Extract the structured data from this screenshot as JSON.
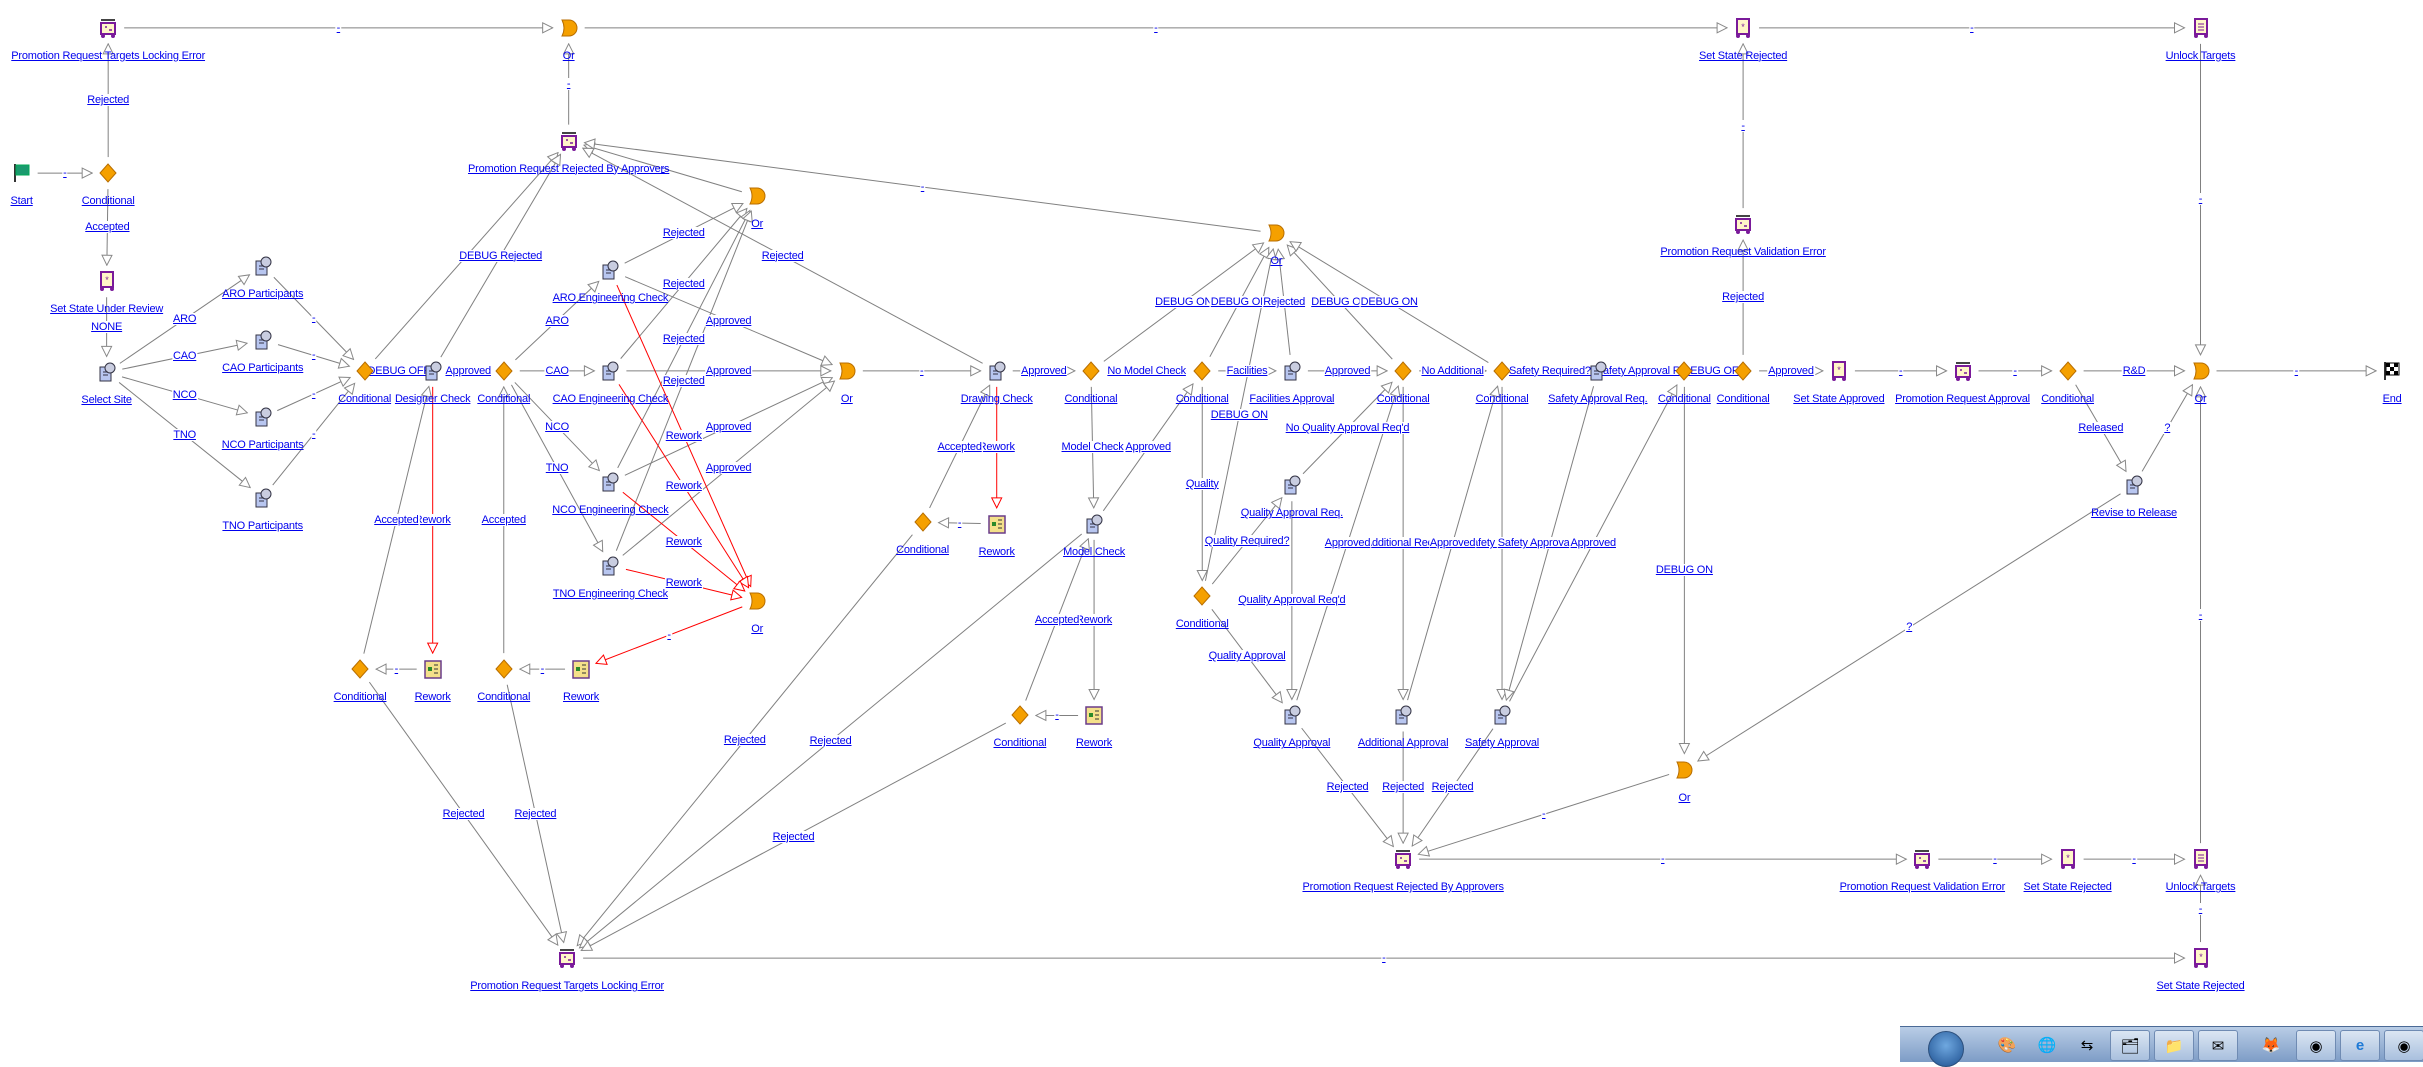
{
  "colors": {
    "link": "#0000ee",
    "edge": "#808080",
    "rework_edge": "#ff0000",
    "conditional": "#f5a000",
    "or_gate": "#f5a000",
    "task": "#a9b8e8",
    "state": "#7a1a9a"
  },
  "nodes": [
    {
      "label": "Promotion Request Targets Locking Error",
      "type": "error"
    },
    {
      "label": "Or",
      "type": "or"
    },
    {
      "label": "Set State Rejected",
      "type": "state"
    },
    {
      "label": "Unlock Targets",
      "type": "unlock"
    },
    {
      "label": "Start",
      "type": "start"
    },
    {
      "label": "Conditional",
      "type": "conditional"
    },
    {
      "label": "Set State Under Review",
      "type": "state"
    },
    {
      "label": "Select Site",
      "type": "task"
    },
    {
      "label": "ARO Participants",
      "type": "task"
    },
    {
      "label": "CAO Participants",
      "type": "task"
    },
    {
      "label": "NCO Participants",
      "type": "task"
    },
    {
      "label": "TNO Participants",
      "type": "task"
    },
    {
      "label": "Conditional",
      "type": "conditional"
    },
    {
      "label": "Designer Check",
      "type": "task"
    },
    {
      "label": "Conditional",
      "type": "conditional"
    },
    {
      "label": "Promotion Request Rejected By Approvers",
      "type": "error"
    },
    {
      "label": "Or",
      "type": "or"
    },
    {
      "label": "ARO Engineering Check",
      "type": "task"
    },
    {
      "label": "CAO Engineering Check",
      "type": "task"
    },
    {
      "label": "NCO Engineering Check",
      "type": "task"
    },
    {
      "label": "TNO Engineering Check",
      "type": "task"
    },
    {
      "label": "Or",
      "type": "or"
    },
    {
      "label": "Or",
      "type": "or"
    },
    {
      "label": "Drawing Check",
      "type": "task"
    },
    {
      "label": "Conditional",
      "type": "conditional"
    },
    {
      "label": "Conditional",
      "type": "conditional"
    },
    {
      "label": "Facilities Approval",
      "type": "task"
    },
    {
      "label": "Conditional",
      "type": "conditional"
    },
    {
      "label": "Conditional",
      "type": "conditional"
    },
    {
      "label": "Safety Approval Req.",
      "type": "task"
    },
    {
      "label": "Conditional",
      "type": "conditional"
    },
    {
      "label": "Conditional",
      "type": "conditional"
    },
    {
      "label": "Set State Approved",
      "type": "state"
    },
    {
      "label": "Promotion Request Approval",
      "type": "error"
    },
    {
      "label": "Conditional",
      "type": "conditional"
    },
    {
      "label": "Or",
      "type": "or"
    },
    {
      "label": "End",
      "type": "end"
    },
    {
      "label": "Or",
      "type": "or"
    },
    {
      "label": "Rework",
      "type": "rework"
    },
    {
      "label": "Conditional",
      "type": "conditional"
    },
    {
      "label": "Model Check",
      "type": "task"
    },
    {
      "label": "Conditional",
      "type": "conditional"
    },
    {
      "label": "Rework",
      "type": "rework"
    },
    {
      "label": "Quality Approval Req.",
      "type": "task"
    },
    {
      "label": "Conditional",
      "type": "conditional"
    },
    {
      "label": "Quality Approval",
      "type": "task"
    },
    {
      "label": "Additional Approval",
      "type": "task"
    },
    {
      "label": "Safety Approval",
      "type": "task"
    },
    {
      "label": "Conditional",
      "type": "conditional"
    },
    {
      "label": "Rework",
      "type": "rework"
    },
    {
      "label": "Conditional",
      "type": "conditional"
    },
    {
      "label": "Rework",
      "type": "rework"
    },
    {
      "label": "Or",
      "type": "or"
    },
    {
      "label": "Promotion Request Rejected By Approvers",
      "type": "error"
    },
    {
      "label": "Promotion Request Validation Error",
      "type": "error"
    },
    {
      "label": "Set State Rejected",
      "type": "state"
    },
    {
      "label": "Unlock Targets",
      "type": "unlock"
    },
    {
      "label": "Set State Rejected",
      "type": "state"
    },
    {
      "label": "Promotion Request Targets Locking Error",
      "type": "error"
    },
    {
      "label": "Promotion Request Validation Error",
      "type": "error"
    },
    {
      "label": "Revise to Release",
      "type": "task"
    }
  ],
  "edges": [
    {
      "from": 1,
      "to": 2,
      "label": "-"
    },
    {
      "from": 2,
      "to": 3,
      "label": "-"
    },
    {
      "from": 3,
      "to": 4,
      "label": "-"
    },
    {
      "from": 5,
      "to": 6,
      "label": "-"
    },
    {
      "from": 6,
      "to": 1,
      "label": "Rejected"
    },
    {
      "from": 6,
      "to": 7,
      "label": "Accepted"
    },
    {
      "from": 7,
      "to": 8,
      "label": "NONE"
    },
    {
      "from": 8,
      "to": 9,
      "label": "ARO"
    },
    {
      "from": 8,
      "to": 10,
      "label": "CAO"
    },
    {
      "from": 8,
      "to": 11,
      "label": "NCO"
    },
    {
      "from": 8,
      "to": 12,
      "label": "TNO"
    },
    {
      "from": 9,
      "to": 13,
      "label": "-"
    },
    {
      "from": 10,
      "to": 13,
      "label": "-"
    },
    {
      "from": 11,
      "to": 13,
      "label": "-"
    },
    {
      "from": 12,
      "to": 13,
      "label": "-"
    },
    {
      "from": 13,
      "to": 14,
      "label": "DEBUG OFF"
    },
    {
      "from": 13,
      "to": 16,
      "label": ""
    },
    {
      "from": 14,
      "to": 16,
      "label": "DEBUG Rejected"
    },
    {
      "from": 14,
      "to": 15,
      "label": "Approved"
    },
    {
      "from": 14,
      "to": 50,
      "label": "Rework",
      "rework": true
    },
    {
      "from": 49,
      "to": 14,
      "label": "Accepted"
    },
    {
      "from": 50,
      "to": 49,
      "label": "-"
    },
    {
      "from": 15,
      "to": 18,
      "label": "ARO"
    },
    {
      "from": 15,
      "to": 19,
      "label": "CAO"
    },
    {
      "from": 15,
      "to": 20,
      "label": "NCO"
    },
    {
      "from": 15,
      "to": 21,
      "label": "TNO"
    },
    {
      "from": 51,
      "to": 15,
      "label": "Accepted"
    },
    {
      "from": 52,
      "to": 51,
      "label": "-"
    },
    {
      "from": 18,
      "to": 17,
      "label": "Rejected"
    },
    {
      "from": 19,
      "to": 17,
      "label": "Rejected"
    },
    {
      "from": 20,
      "to": 17,
      "label": "Rejected"
    },
    {
      "from": 21,
      "to": 17,
      "label": "Rejected"
    },
    {
      "from": 18,
      "to": 22,
      "label": "Approved"
    },
    {
      "from": 19,
      "to": 22,
      "label": "Approved"
    },
    {
      "from": 20,
      "to": 22,
      "label": "Approved"
    },
    {
      "from": 21,
      "to": 22,
      "label": "Approved"
    },
    {
      "from": 18,
      "to": 23,
      "label": "Rework",
      "rework": true
    },
    {
      "from": 19,
      "to": 23,
      "label": "Rework",
      "rework": true
    },
    {
      "from": 20,
      "to": 23,
      "label": "Rework",
      "rework": true
    },
    {
      "from": 21,
      "to": 23,
      "label": "Rework",
      "rework": true
    },
    {
      "from": 23,
      "to": 52,
      "label": "-",
      "rework": true
    },
    {
      "from": 17,
      "to": 16,
      "label": "-"
    },
    {
      "from": 16,
      "to": 2,
      "label": "-"
    },
    {
      "from": 24,
      "to": 16,
      "label": "Rejected"
    },
    {
      "from": 38,
      "to": 16,
      "label": "-"
    },
    {
      "from": 22,
      "to": 24,
      "label": "-"
    },
    {
      "from": 24,
      "to": 25,
      "label": "Approved"
    },
    {
      "from": 24,
      "to": 39,
      "label": "Rework",
      "rework": true
    },
    {
      "from": 40,
      "to": 24,
      "label": "Accepted"
    },
    {
      "from": 39,
      "to": 40,
      "label": "-"
    },
    {
      "from": 25,
      "to": 26,
      "label": "No Model Check"
    },
    {
      "from": 25,
      "to": 41,
      "label": "Model Check"
    },
    {
      "from": 41,
      "to": 26,
      "label": "Approved"
    },
    {
      "from": 41,
      "to": 43,
      "label": "Rework"
    },
    {
      "from": 42,
      "to": 41,
      "label": "Accepted"
    },
    {
      "from": 43,
      "to": 42,
      "label": "-"
    },
    {
      "from": 25,
      "to": 38,
      "label": "DEBUG ON"
    },
    {
      "from": 26,
      "to": 38,
      "label": "DEBUG ON"
    },
    {
      "from": 26,
      "to": 27,
      "label": "Facilities"
    },
    {
      "from": 26,
      "to": 45,
      "label": "Quality"
    },
    {
      "from": 27,
      "to": 38,
      "label": "Rejected"
    },
    {
      "from": 27,
      "to": 28,
      "label": "Approved"
    },
    {
      "from": 28,
      "to": 38,
      "label": "DEBUG ON"
    },
    {
      "from": 29,
      "to": 38,
      "label": "DEBUG ON"
    },
    {
      "from": 45,
      "to": 38,
      "label": "DEBUG ON"
    },
    {
      "from": 28,
      "to": 29,
      "label": "No Additional"
    },
    {
      "from": 28,
      "to": 47,
      "label": "Additional Req'd"
    },
    {
      "from": 29,
      "to": 30,
      "label": "Safety Required?"
    },
    {
      "from": 29,
      "to": 48,
      "label": "Safety Approval"
    },
    {
      "from": 30,
      "to": 31,
      "label": "Safety Approval Re"
    },
    {
      "from": 30,
      "to": 48,
      "label": "Safety Approval Req'd"
    },
    {
      "from": 31,
      "to": 32,
      "label": "DEBUG OFF"
    },
    {
      "from": 31,
      "to": 53,
      "label": "DEBUG ON"
    },
    {
      "from": 32,
      "to": 60,
      "label": "Rejected"
    },
    {
      "from": 60,
      "to": 3,
      "label": "-"
    },
    {
      "from": 32,
      "to": 33,
      "label": "Approved"
    },
    {
      "from": 33,
      "to": 34,
      "label": "-"
    },
    {
      "from": 34,
      "to": 35,
      "label": "-"
    },
    {
      "from": 35,
      "to": 36,
      "label": "R&D"
    },
    {
      "from": 35,
      "to": 61,
      "label": "Released"
    },
    {
      "from": 61,
      "to": 36,
      "label": "?"
    },
    {
      "from": 61,
      "to": 53,
      "label": "?"
    },
    {
      "from": 36,
      "to": 37,
      "label": "-"
    },
    {
      "from": 4,
      "to": 36,
      "label": "-"
    },
    {
      "from": 57,
      "to": 36,
      "label": "-"
    },
    {
      "from": 44,
      "to": 28,
      "label": "No Quality Approval Req'd"
    },
    {
      "from": 45,
      "to": 44,
      "label": "Quality Required?"
    },
    {
      "from": 44,
      "to": 46,
      "label": "Quality Approval Req'd"
    },
    {
      "from": 45,
      "to": 46,
      "label": "Quality Approval"
    },
    {
      "from": 46,
      "to": 28,
      "label": "Approved"
    },
    {
      "from": 47,
      "to": 29,
      "label": "Approved"
    },
    {
      "from": 48,
      "to": 31,
      "label": "Approved"
    },
    {
      "from": 46,
      "to": 54,
      "label": "Rejected"
    },
    {
      "from": 47,
      "to": 54,
      "label": "Rejected"
    },
    {
      "from": 48,
      "to": 54,
      "label": "Rejected"
    },
    {
      "from": 53,
      "to": 54,
      "label": "-"
    },
    {
      "from": 54,
      "to": 55,
      "label": "-"
    },
    {
      "from": 55,
      "to": 56,
      "label": "-"
    },
    {
      "from": 56,
      "to": 57,
      "label": "-"
    },
    {
      "from": 58,
      "to": 57,
      "label": "-"
    },
    {
      "from": 59,
      "to": 58,
      "label": "-"
    },
    {
      "from": 49,
      "to": 59,
      "label": "Rejected"
    },
    {
      "from": 51,
      "to": 59,
      "label": "Rejected"
    },
    {
      "from": 40,
      "to": 59,
      "label": "Rejected"
    },
    {
      "from": 41,
      "to": 59,
      "label": "Rejected"
    },
    {
      "from": 42,
      "to": 59,
      "label": "Rejected"
    }
  ],
  "taskbar": {
    "start_icon": "windows-orb-icon",
    "tray_icons": [
      "paint-icon",
      "network-globe-icon",
      "switch-arrows-icon"
    ],
    "app_buttons": [
      "windows-explorer-icon",
      "file-manager-icon",
      "outlook-icon",
      "firefox-icon",
      "chrome-icon",
      "internet-explorer-icon",
      "chrome-icon"
    ]
  }
}
